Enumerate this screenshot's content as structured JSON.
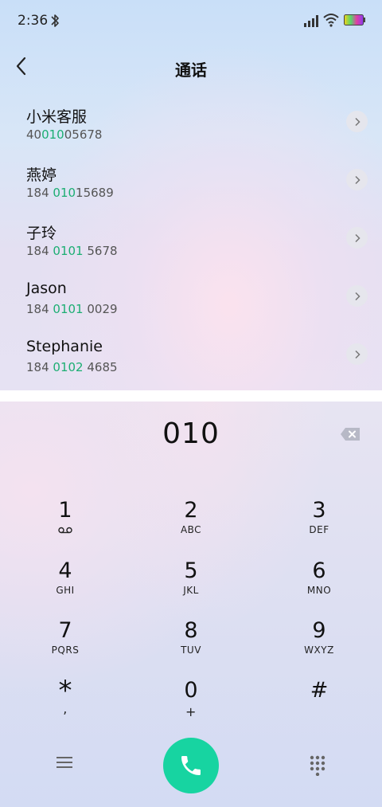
{
  "status_bar": {
    "time": "2:36"
  },
  "header": {
    "title": "通话"
  },
  "contacts": [
    {
      "name": "小米客服",
      "number_pre": "40",
      "number_match": "010",
      "number_post": "05678"
    },
    {
      "name": "燕婷",
      "number_pre": "184 ",
      "number_match": "010",
      "number_post": "15689"
    },
    {
      "name": "子玲",
      "number_pre": "184 ",
      "number_match": "0101",
      "number_post": " 5678"
    },
    {
      "name": "Jason",
      "number_pre": "184 ",
      "number_match": "0101",
      "number_post": " 0029"
    },
    {
      "name": "Stephanie",
      "number_pre": "184 ",
      "number_match": "0102",
      "number_post": " 4685"
    }
  ],
  "dial": {
    "input": "010"
  },
  "keypad": [
    {
      "digit": "1",
      "letters": ""
    },
    {
      "digit": "2",
      "letters": "ABC"
    },
    {
      "digit": "3",
      "letters": "DEF"
    },
    {
      "digit": "4",
      "letters": "GHI"
    },
    {
      "digit": "5",
      "letters": "JKL"
    },
    {
      "digit": "6",
      "letters": "MNO"
    },
    {
      "digit": "7",
      "letters": "PQRS"
    },
    {
      "digit": "8",
      "letters": "TUV"
    },
    {
      "digit": "9",
      "letters": "WXYZ"
    },
    {
      "digit": "*",
      "letters": ","
    },
    {
      "digit": "0",
      "letters": "+"
    },
    {
      "digit": "#",
      "letters": ""
    }
  ],
  "colors": {
    "accent": "#17d4a1",
    "match": "#1cae73"
  },
  "icons": {
    "back": "back-chevron-icon",
    "backspace": "backspace-icon",
    "menu": "menu-icon",
    "call": "phone-icon",
    "keypad": "dialpad-icon",
    "voicemail": "voicemail-icon"
  }
}
